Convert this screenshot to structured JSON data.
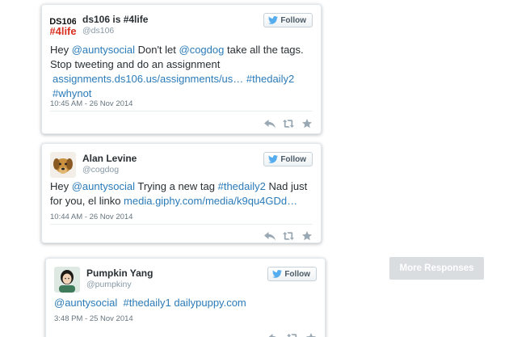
{
  "tweets": [
    {
      "name": "ds106 is #4life",
      "handle": "@ds106",
      "follow": "Follow",
      "text_intro": "Hey ",
      "mention1": "@auntysocial",
      "text_mid": " Don't let ",
      "mention2": "@cogdog",
      "text_rest": " take all the tags. Stop tweeting and do an assignment",
      "link": "assignments.ds106.us/assignments/us…",
      "hashtag1": "#thedaily2",
      "hashtag2": "#whynot",
      "date": "10:45 AM - 26 Nov 2014",
      "avatar_text": "DS106 #4life"
    },
    {
      "name": "Alan Levine",
      "handle": "@cogdog",
      "follow": "Follow",
      "text_intro": "Hey ",
      "mention1": "@auntysocial",
      "text_mid": " Trying a new tag ",
      "hashtag1": "#thedaily2",
      "text_rest": " Nad just for you, el linko ",
      "link": "media.giphy.com/media/k9qu4GDd…",
      "date": "10:44 AM - 26 Nov 2014"
    },
    {
      "name": "Pumpkin Yang",
      "handle": "@pumpkiny",
      "follow": "Follow",
      "mention1": "@auntysocial",
      "hashtag1": "#thedaily1",
      "link": "dailypuppy.com",
      "date": "3:48 PM - 25 Nov 2014"
    }
  ],
  "more_responses": "More Responses",
  "colors": {
    "link": "#2b7bb9",
    "name": "#292f33",
    "meta": "#8899a6",
    "button_bg": "#dadde0"
  },
  "icons": [
    "twitter-bird-icon",
    "reply-icon",
    "retweet-icon",
    "favorite-star-icon"
  ]
}
